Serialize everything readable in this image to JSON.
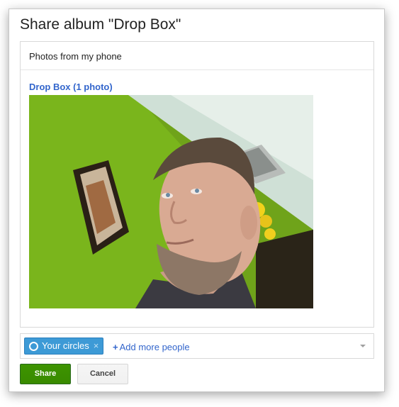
{
  "dialog": {
    "title": "Share album \"Drop Box\""
  },
  "content": {
    "source_label": "Photos from my phone",
    "album_link": "Drop Box (1 photo)",
    "photo_alt": "photo"
  },
  "share": {
    "chip_label": "Your circles",
    "chip_close": "×",
    "add_more_plus": "+",
    "add_more_label": "Add more people",
    "chip_color": "#3d9ad6"
  },
  "buttons": {
    "share_label": "Share",
    "cancel_label": "Cancel",
    "share_color": "#3d9400"
  }
}
